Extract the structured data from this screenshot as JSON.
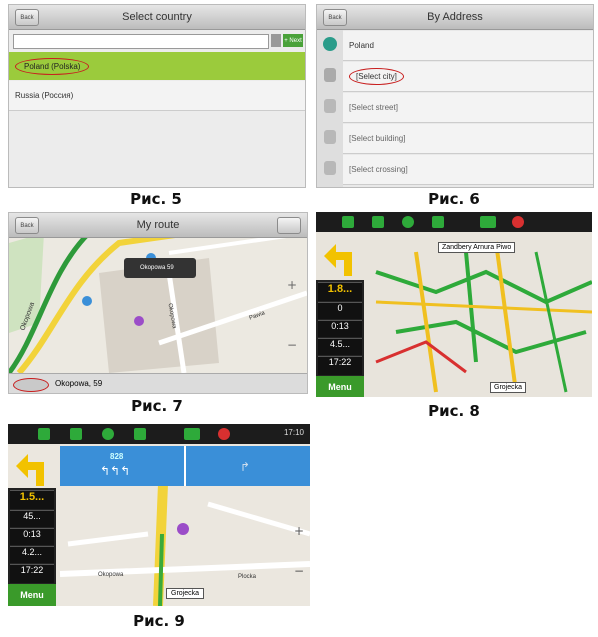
{
  "fig5": {
    "caption": "Рис. 5",
    "title": "Select country",
    "back": "Back",
    "search_btn": "+ Next",
    "items": [
      "Poland (Polska)",
      "Russia (Россия)"
    ]
  },
  "fig6": {
    "caption": "Рис. 6",
    "title": "By Address",
    "back": "Back",
    "rows": [
      "Poland",
      "[Select city]",
      "[Select street]",
      "[Select building]",
      "[Select crossing]"
    ]
  },
  "fig7": {
    "caption": "Рис. 7",
    "title": "My route",
    "back": "Back",
    "popup": "Okopowa 59",
    "bottom_address": "Okopowa, 59",
    "streets": [
      "Okopowa",
      "Okopowa",
      "Pawia"
    ]
  },
  "fig8": {
    "caption": "Рис. 8",
    "poi_label": "Zandbery Arnura Piwo",
    "place_label": "Grojecka",
    "metrics": [
      "1.8...",
      "0",
      "0:13",
      "4.5...",
      "17:22"
    ],
    "menu": "Menu"
  },
  "fig9": {
    "caption": "Рис. 9",
    "time": "17:10",
    "lane_label": "828",
    "metrics": [
      "1.5...",
      "45...",
      "0:13",
      "4.2...",
      "17:22"
    ],
    "menu": "Menu",
    "street_label": "Grojecka",
    "streets": [
      "Okopowa",
      "Grojecka",
      "Plocka"
    ]
  },
  "colors": {
    "highlight": "#9bcb3c",
    "ellipse": "#c81e1e",
    "nav_blue": "#3a8fd8",
    "arrow": "#f2c200",
    "menu_green": "#3a9a2a"
  }
}
